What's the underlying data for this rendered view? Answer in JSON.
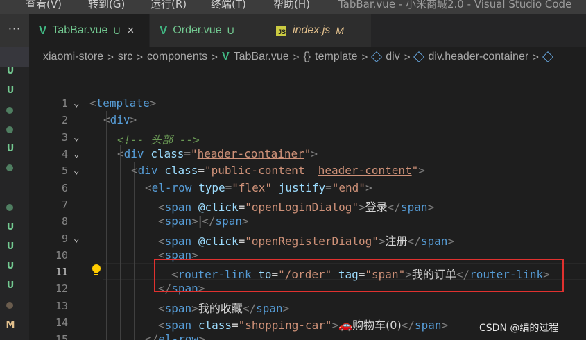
{
  "menu": {
    "items": [
      "查看(V)",
      "转到(G)",
      "运行(R)",
      "终端(T)",
      "帮助(H)"
    ],
    "window_title": "TabBar.vue - 小米商城2.0 - Visual Studio Code"
  },
  "tabs": [
    {
      "name": "TabBar.vue",
      "badge": "U",
      "type": "vue",
      "active": true,
      "close": "×"
    },
    {
      "name": "Order.vue",
      "badge": "U",
      "type": "vue",
      "active": false
    },
    {
      "name": "index.js",
      "badge": "M",
      "type": "js",
      "active": false
    }
  ],
  "more_actions": "···",
  "explorer_badges": [
    "U",
    "U",
    "●",
    "●",
    "U",
    "●",
    "●",
    "U",
    "U",
    "U",
    "U",
    "●",
    "M"
  ],
  "breadcrumb": [
    "xiaomi-store",
    "src",
    "components",
    "TabBar.vue",
    "template",
    "div",
    "div.header-container"
  ],
  "editor": {
    "lines": [
      {
        "n": "1",
        "text": "<template>"
      },
      {
        "n": "2",
        "text": "<div>"
      },
      {
        "n": "3",
        "text": "<!-- 头部 -->"
      },
      {
        "n": "4",
        "text": "<div class=\"header-container\">"
      },
      {
        "n": "5",
        "text": "<div class=\"public-content  header-content\">"
      },
      {
        "n": "6",
        "text": "<el-row type=\"flex\" justify=\"end\">"
      },
      {
        "n": "7",
        "text": "<span @click=\"openLoginDialog\">登录</span>"
      },
      {
        "n": "8",
        "text": "<span>|</span>"
      },
      {
        "n": "9",
        "text": "<span @click=\"openRegisterDialog\">注册</span>"
      },
      {
        "n": "10",
        "text": "<span>"
      },
      {
        "n": "11",
        "text": "<router-link to=\"/order\" tag=\"span\">我的订单</router-link>"
      },
      {
        "n": "12",
        "text": "</span>"
      },
      {
        "n": "13",
        "text": "<span>我的收藏</span>"
      },
      {
        "n": "14",
        "text": "<span class=\"shopping-car\">🚗购物车(0)</span>"
      },
      {
        "n": "15",
        "text": "</el-row>"
      }
    ],
    "current_line": 11
  },
  "watermark": "CSDN @编的过程",
  "colors": {
    "highlight_box": "#e0312f",
    "vue_green": "#41b883",
    "tag": "#569cd6",
    "attr": "#9cdcfe",
    "string": "#ce9178"
  }
}
